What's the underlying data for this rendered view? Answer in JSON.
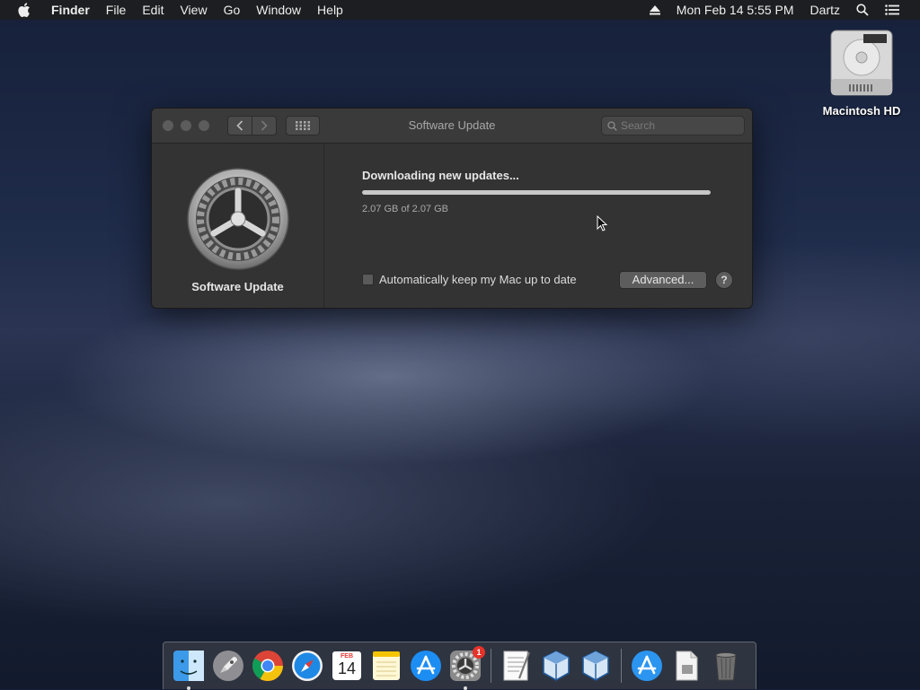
{
  "menubar": {
    "app_name": "Finder",
    "items": [
      "File",
      "Edit",
      "View",
      "Go",
      "Window",
      "Help"
    ],
    "datetime": "Mon Feb 14  5:55 PM",
    "user": "Dartz"
  },
  "desktop": {
    "drive_label": "Macintosh HD"
  },
  "window": {
    "title": "Software Update",
    "search_placeholder": "Search",
    "pane_label": "Software Update",
    "status": "Downloading new updates...",
    "progress_fraction": 1.0,
    "size_info": "2.07 GB of 2.07 GB",
    "auto_update_label": "Automatically keep my Mac up to date",
    "auto_update_checked": false,
    "advanced_label": "Advanced...",
    "help_label": "?"
  },
  "dock": {
    "apps": [
      "Finder",
      "Launchpad",
      "Chrome",
      "Safari",
      "Calendar",
      "Notes",
      "App Store",
      "System Preferences",
      "TextEdit",
      "VirtualBox",
      "VirtualBox VM",
      "App Store Downloads",
      "Document",
      "Trash"
    ],
    "calendar_month": "FEB",
    "calendar_day": "14",
    "prefs_badge": "1"
  },
  "colors": {
    "window_bg": "#333333",
    "progress_fill": "#c8c8c8",
    "badge": "#e5332a"
  }
}
